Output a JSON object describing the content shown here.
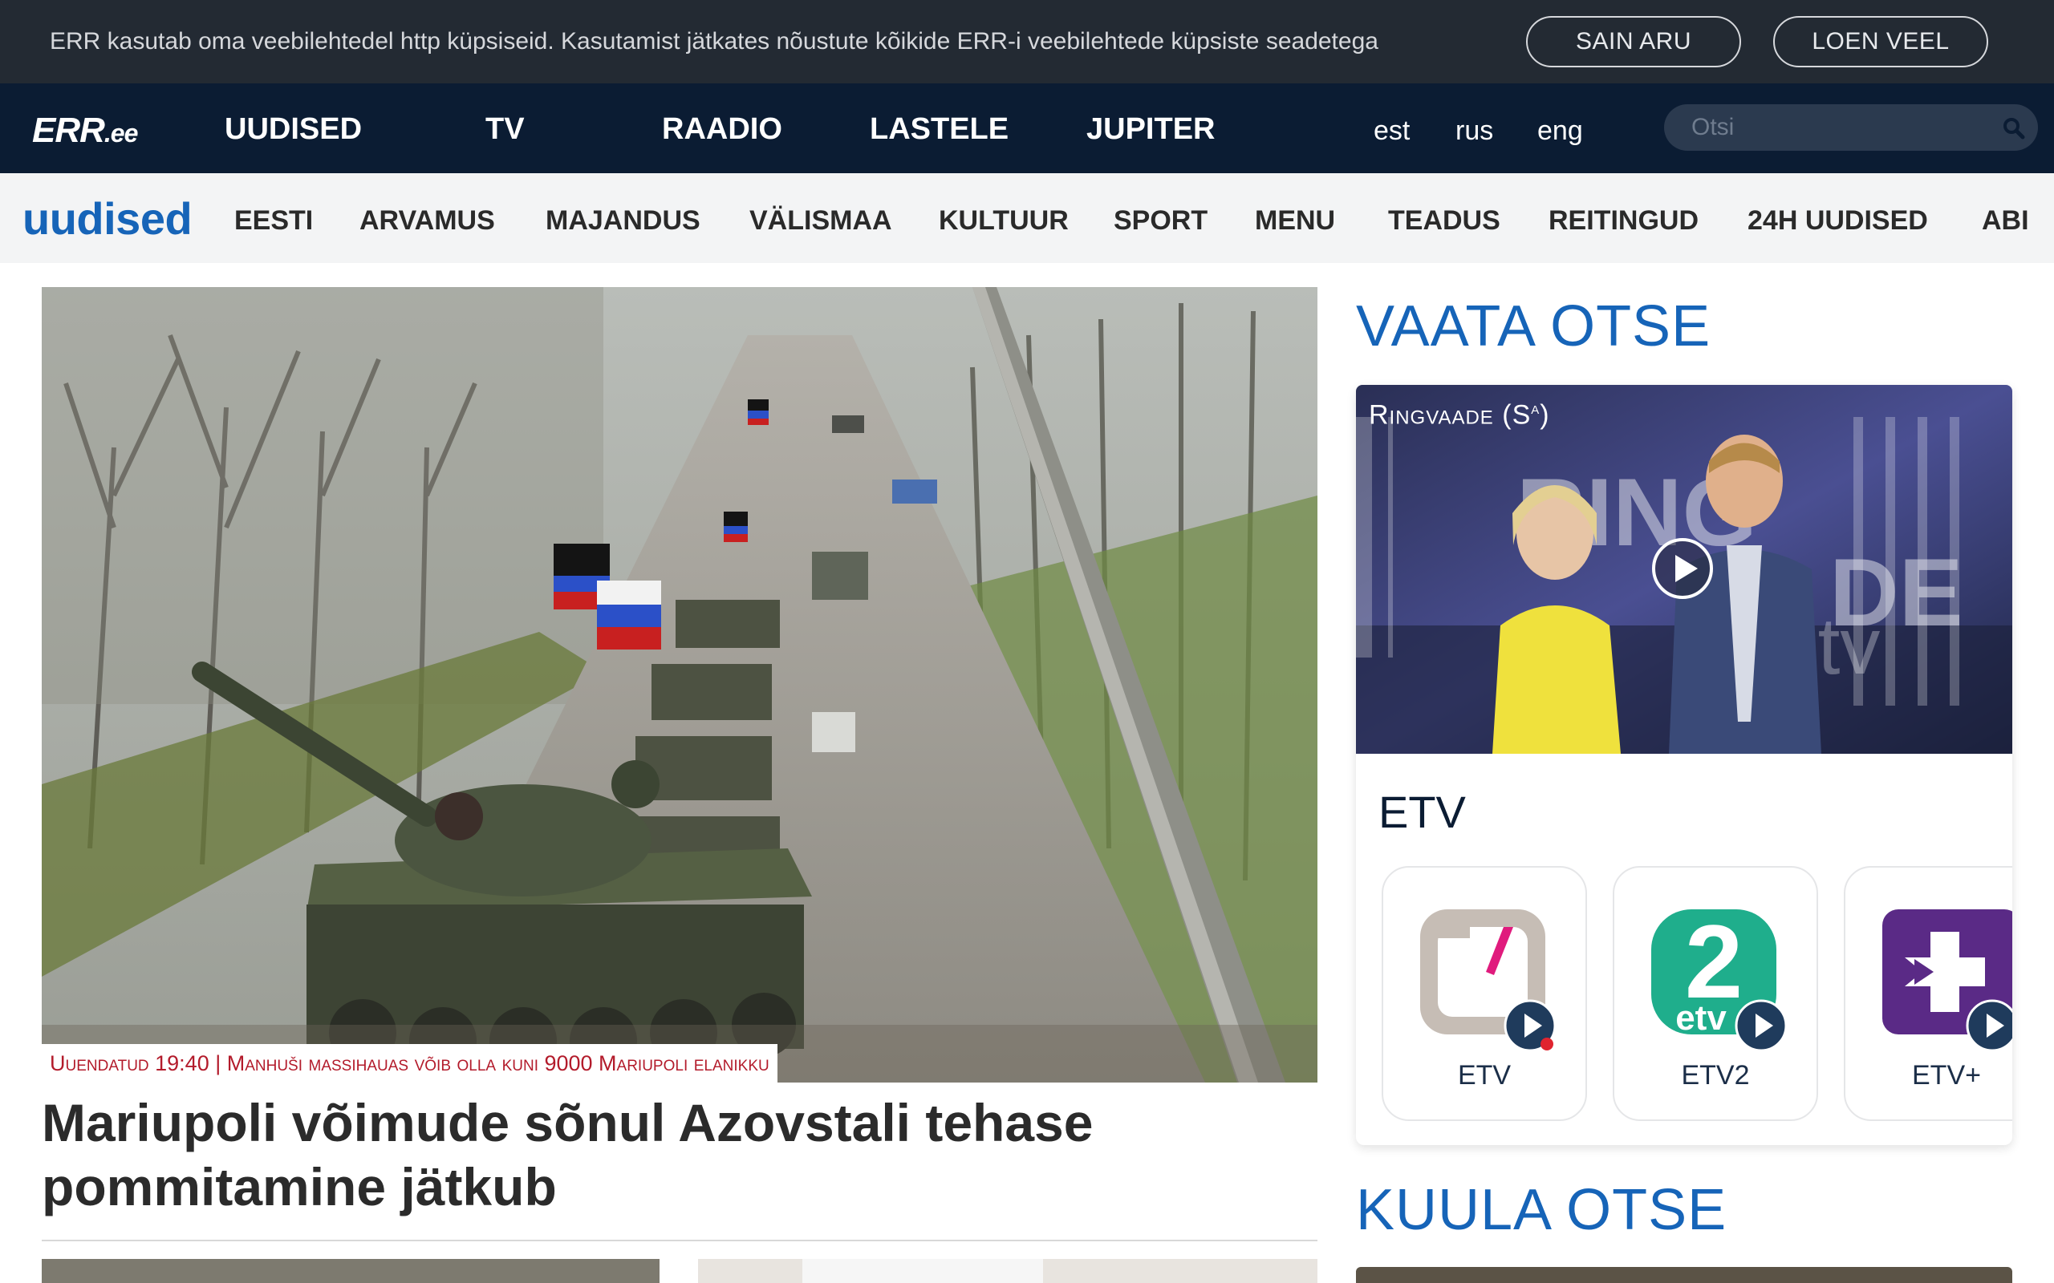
{
  "cookie": {
    "text": "ERR kasutab oma veebilehtedel http küpsiseid. Kasutamist jätkates nõustute kõikide ERR-i veebilehtede küpsiste seadetega",
    "agree": "SAIN ARU",
    "read_more": "LOEN VEEL"
  },
  "topnav": {
    "logo": "ERR",
    "logo_suffix": ".ee",
    "items": [
      "UUDISED",
      "TV",
      "RAADIO",
      "LASTELE",
      "JUPITER"
    ],
    "langs": [
      "est",
      "rus",
      "eng"
    ],
    "search_placeholder": "Otsi"
  },
  "section": {
    "title": "uudised",
    "items": [
      "EESTI",
      "ARVAMUS",
      "MAJANDUS",
      "VÄLISMAA",
      "KULTUUR",
      "SPORT",
      "MENU",
      "TEADUS",
      "REITINGUD",
      "24H UUDISED",
      "ABI"
    ]
  },
  "lead": {
    "caption": "Uuendatud 19:40 | Manhuši massihauas võib olla kuni 9000 Mariupoli elanikku",
    "headline": "Mariupoli võimude sõnul Azovstali tehase pommitamine jätkub"
  },
  "live": {
    "heading": "VAATA OTSE",
    "show_title": "Ringvaade (S",
    "show_sup": "a",
    "show_close": ")",
    "channel_group": "ETV",
    "channels": [
      {
        "name": "ETV",
        "color": "#c6bdb5",
        "live": true
      },
      {
        "name": "ETV2",
        "color": "#1fae8c",
        "live": false
      },
      {
        "name": "ETV+",
        "color": "#5a2a86",
        "live": false
      }
    ]
  },
  "radio": {
    "heading": "KUULA OTSE"
  },
  "colors": {
    "brand_blue": "#1664b8",
    "nav_dark": "#0b1c33",
    "live_red": "#e0242f",
    "caption_red": "#b31b2b"
  }
}
